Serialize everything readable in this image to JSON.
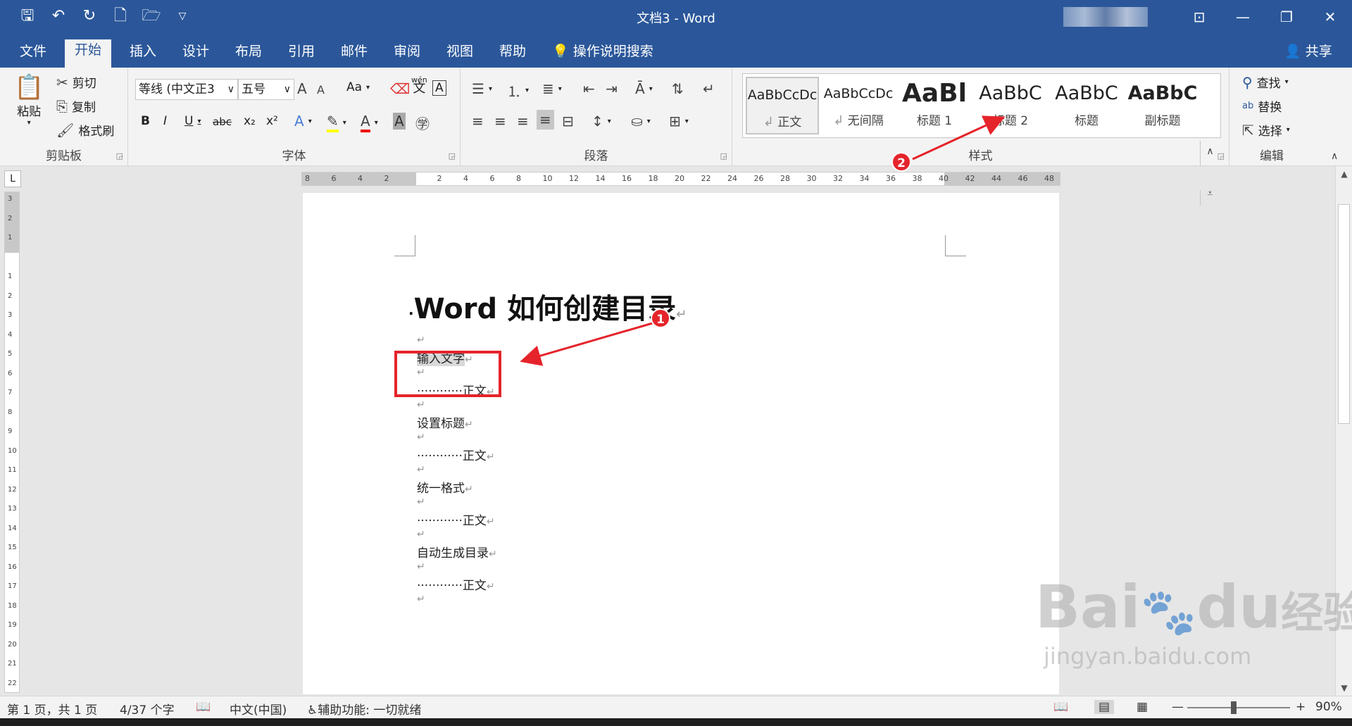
{
  "window": {
    "title": "文档3  -  Word"
  },
  "qat": {
    "icons": [
      "save-icon",
      "undo-icon",
      "redo-icon",
      "new-doc-icon",
      "open-icon",
      "customize-icon"
    ]
  },
  "tabs": [
    {
      "label": "文件",
      "active": false
    },
    {
      "label": "开始",
      "active": true
    },
    {
      "label": "插入",
      "active": false
    },
    {
      "label": "设计",
      "active": false
    },
    {
      "label": "布局",
      "active": false
    },
    {
      "label": "引用",
      "active": false
    },
    {
      "label": "邮件",
      "active": false
    },
    {
      "label": "审阅",
      "active": false
    },
    {
      "label": "视图",
      "active": false
    },
    {
      "label": "帮助",
      "active": false
    }
  ],
  "tell_me": "操作说明搜索",
  "share": "共享",
  "clipboard": {
    "paste": "粘贴",
    "cut": "剪切",
    "copy": "复制",
    "format_painter": "格式刷",
    "label": "剪贴板"
  },
  "font": {
    "name": "等线 (中文正3",
    "size": "五号",
    "label": "字体",
    "bold": "B",
    "italic": "I",
    "underline": "U",
    "strike": "abc",
    "sub": "x₂",
    "sup": "x²",
    "change_case": "Aa",
    "grow": "A",
    "shrink": "A",
    "phonetic_top": "wén",
    "phonetic_bottom": "文",
    "border": "A"
  },
  "paragraph": {
    "label": "段落"
  },
  "styles": {
    "label": "样式",
    "items": [
      {
        "sample": "AaBbCcDc",
        "name": "正文",
        "para": true
      },
      {
        "sample": "AaBbCcDc",
        "name": "无间隔",
        "para": true
      },
      {
        "sample": "AaBl",
        "name": "标题 1",
        "para": false
      },
      {
        "sample": "AaBbC",
        "name": "标题 2",
        "para": false
      },
      {
        "sample": "AaBbC",
        "name": "标题",
        "para": false
      },
      {
        "sample": "AaBbC",
        "name": "副标题",
        "para": false
      }
    ]
  },
  "editing": {
    "label": "编辑",
    "find": "查找",
    "replace": "替换",
    "select": "选择"
  },
  "ruler": {
    "h_ticks": [
      "8",
      "6",
      "4",
      "2",
      "",
      "2",
      "4",
      "6",
      "8",
      "10",
      "12",
      "14",
      "16",
      "18",
      "20",
      "22",
      "24",
      "26",
      "28",
      "30",
      "32",
      "34",
      "36",
      "38",
      "40",
      "42",
      "44",
      "46",
      "48"
    ],
    "v_ticks": [
      "3",
      "2",
      "1",
      "",
      "1",
      "2",
      "3",
      "4",
      "5",
      "6",
      "7",
      "8",
      "9",
      "10",
      "11",
      "12",
      "13",
      "14",
      "15",
      "16",
      "17",
      "18",
      "19",
      "20",
      "21",
      "22"
    ],
    "corner": "L"
  },
  "document": {
    "heading": "Word 如何创建目录",
    "lines": [
      "",
      "输入文字",
      "",
      "············正文",
      "",
      "设置标题",
      "",
      "············正文",
      "",
      "统一格式",
      "",
      "············正文",
      "",
      "自动生成目录",
      "",
      "············正文",
      ""
    ]
  },
  "annotations": {
    "badge1": "1",
    "badge2": "2",
    "accent": "#e5242b"
  },
  "status": {
    "page": "第 1 页，共 1 页",
    "words": "4/37 个字",
    "language": "中文(中国)",
    "accessibility": "辅助功能: 一切就绪",
    "zoom": "90%",
    "zoom_level": 0.9
  },
  "watermark": {
    "brand": "Bai",
    "brand2": "du",
    "brand3": "经验",
    "url": "jingyan.baidu.com"
  },
  "colors": {
    "accent": "#2b579a",
    "ribbon": "#f3f3f3"
  }
}
